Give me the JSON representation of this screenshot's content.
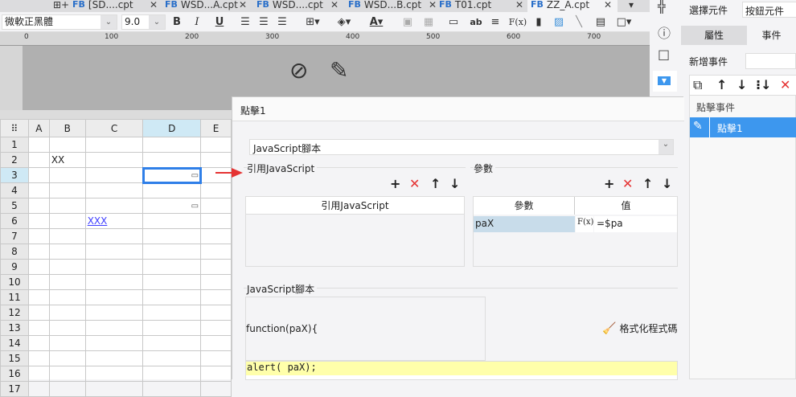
{
  "tabs": [
    {
      "label": "[SD....cpt"
    },
    {
      "label": "WSD...A.cpt"
    },
    {
      "label": "WSD....cpt"
    },
    {
      "label": "WSD...B.cpt"
    },
    {
      "label": "T01.cpt"
    },
    {
      "label": "ZZ_A.cpt"
    }
  ],
  "toolbar": {
    "font": "微軟正黑體",
    "size": "9.0",
    "bold": "B",
    "italic": "I",
    "underline": "U",
    "fx": "F(x)",
    "ab": "ab"
  },
  "ruler": [
    "0",
    "100",
    "200",
    "300",
    "400",
    "500",
    "600",
    "700"
  ],
  "sheet": {
    "columns": [
      "A",
      "B",
      "C",
      "D",
      "E"
    ],
    "rows": [
      "1",
      "2",
      "3",
      "4",
      "5",
      "6",
      "7",
      "8",
      "9",
      "10",
      "11",
      "12",
      "13",
      "14",
      "15",
      "16",
      "17"
    ],
    "b2": "XX",
    "c6": "XXX"
  },
  "right_panel": {
    "select_label": "選擇元件",
    "select_value": "按鈕元件",
    "tab_props": "屬性",
    "tab_events": "事件",
    "add_event": "新增事件",
    "event_group": "點擊事件",
    "event_item": "點擊1"
  },
  "dialog": {
    "title": "點擊1",
    "type_select": "JavaScript腳本",
    "ref_section": "引用JavaScript",
    "ref_col": "引用JavaScript",
    "param_section": "參數",
    "param_col": "參數",
    "value_col": "值",
    "params": [
      {
        "name": "paX",
        "value": "=$pa"
      }
    ],
    "script_section": "JavaScript腳本",
    "script_header": "function(paX){",
    "script_line": "alert( paX);",
    "format_button": "格式化程式碼"
  },
  "colors": {
    "accent": "#3d97ee",
    "selection": "#2f7fe8",
    "delete": "#e53333",
    "highlight": "#ffffaa"
  }
}
